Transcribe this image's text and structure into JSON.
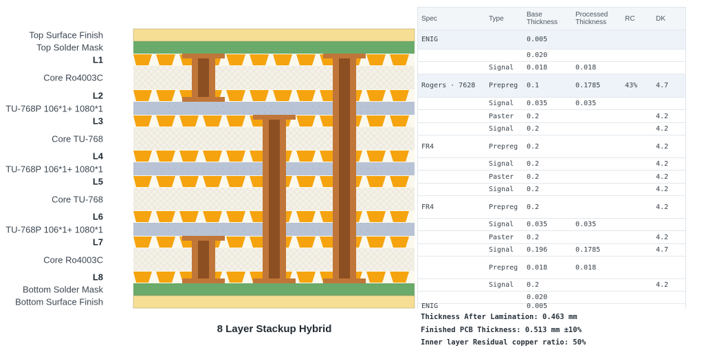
{
  "stackup": {
    "title": "8 Layer Stackup Hybrid",
    "colors": {
      "surface_finish": "#f6de94",
      "solder_mask": "#6aaa6a",
      "copper": "#f5a30e",
      "core": "#f3f0e6",
      "prepreg": "#b9c5d6",
      "via_outer": "#c07638",
      "via_inner": "#8c4f22"
    },
    "layers": [
      {
        "label": "Top Surface Finish",
        "kind": "finish",
        "bold": false
      },
      {
        "label": "Top Solder Mask",
        "kind": "mask",
        "bold": false
      },
      {
        "label": "L1",
        "kind": "copper",
        "bold": true
      },
      {
        "label": "Core Ro4003C",
        "kind": "core",
        "bold": false
      },
      {
        "label": "L2",
        "kind": "copper",
        "bold": true
      },
      {
        "label": "TU-768P 106*1+ 1080*1",
        "kind": "prepreg",
        "bold": false
      },
      {
        "label": "L3",
        "kind": "copper",
        "bold": true
      },
      {
        "label": "Core TU-768",
        "kind": "core",
        "bold": false
      },
      {
        "label": "L4",
        "kind": "copper",
        "bold": true
      },
      {
        "label": "TU-768P 106*1+ 1080*1",
        "kind": "prepreg",
        "bold": false
      },
      {
        "label": "L5",
        "kind": "copper",
        "bold": true
      },
      {
        "label": "Core TU-768",
        "kind": "core",
        "bold": false
      },
      {
        "label": "L6",
        "kind": "copper",
        "bold": true
      },
      {
        "label": "TU-768P 106*1+ 1080*1",
        "kind": "prepreg",
        "bold": false
      },
      {
        "label": "L7",
        "kind": "copper",
        "bold": true
      },
      {
        "label": "Core Ro4003C",
        "kind": "core",
        "bold": false
      },
      {
        "label": "L8",
        "kind": "copper",
        "bold": true
      },
      {
        "label": "Bottom Solder Mask",
        "kind": "mask",
        "bold": false
      },
      {
        "label": "Bottom Surface Finish",
        "kind": "finish",
        "bold": false
      }
    ],
    "vias": [
      {
        "name": "via-blind-top",
        "from_layer": "L1",
        "to_layer": "L2"
      },
      {
        "name": "via-blind-bottom",
        "from_layer": "L7",
        "to_layer": "L8"
      },
      {
        "name": "via-buried",
        "from_layer": "L3",
        "to_layer": "L8"
      },
      {
        "name": "via-through",
        "from_layer": "L1",
        "to_layer": "L8"
      }
    ]
  },
  "table": {
    "headers": {
      "spec": "Spec",
      "type": "Type",
      "base_l1": "Base",
      "base_l2": "Thickness",
      "proc_l1": "Processed",
      "proc_l2": "Thickness",
      "rc": "RC",
      "dk": "DK"
    },
    "rows": [
      {
        "spec": "ENIG",
        "type": "",
        "base": "0.005",
        "processed": "",
        "rc": "",
        "dk": ""
      },
      {
        "spec": "",
        "type": "",
        "base": "0.020",
        "processed": "",
        "rc": "",
        "dk": ""
      },
      {
        "spec": "",
        "type": "Signal",
        "base": "0.018",
        "processed": "0.018",
        "rc": "",
        "dk": ""
      },
      {
        "spec": "Rogers · 7628",
        "type": "Prepreg",
        "base": "0.1",
        "processed": "0.1785",
        "rc": "43%",
        "dk": "4.7"
      },
      {
        "spec": "",
        "type": "Signal",
        "base": "0.035",
        "processed": "0.035",
        "rc": "",
        "dk": ""
      },
      {
        "spec": "",
        "type": "Paster",
        "base": "0.2",
        "processed": "",
        "rc": "",
        "dk": "4.2"
      },
      {
        "spec": "",
        "type": "Signal",
        "base": "0.2",
        "processed": "",
        "rc": "",
        "dk": "4.2"
      },
      {
        "spec": "FR4",
        "type": "Prepreg",
        "base": "0.2",
        "processed": "",
        "rc": "",
        "dk": "4.2"
      },
      {
        "spec": "",
        "type": "Signal",
        "base": "0.2",
        "processed": "",
        "rc": "",
        "dk": "4.2"
      },
      {
        "spec": "",
        "type": "Paster",
        "base": "0.2",
        "processed": "",
        "rc": "",
        "dk": "4.2"
      },
      {
        "spec": "",
        "type": "Signal",
        "base": "0.2",
        "processed": "",
        "rc": "",
        "dk": "4.2"
      },
      {
        "spec": "FR4",
        "type": "Prepreg",
        "base": "0.2",
        "processed": "",
        "rc": "",
        "dk": "4.2"
      },
      {
        "spec": "",
        "type": "Signal",
        "base": "0.035",
        "processed": "0.035",
        "rc": "",
        "dk": ""
      },
      {
        "spec": "",
        "type": "Paster",
        "base": "0.2",
        "processed": "",
        "rc": "",
        "dk": "4.2"
      },
      {
        "spec": "",
        "type": "Signal",
        "base": "0.196",
        "processed": "0.1785",
        "rc": "",
        "dk": "4.7"
      },
      {
        "spec": "",
        "type": "Prepreg",
        "base": "0.018",
        "processed": "0.018",
        "rc": "",
        "dk": ""
      },
      {
        "spec": "",
        "type": "Signal",
        "base": "0.2",
        "processed": "",
        "rc": "",
        "dk": "4.2"
      },
      {
        "spec": "",
        "type": "",
        "base": "0.020",
        "processed": "",
        "rc": "",
        "dk": ""
      },
      {
        "spec": "ENIG",
        "type": "",
        "base": "0.005",
        "processed": "",
        "rc": "",
        "dk": ""
      }
    ]
  },
  "summary": {
    "thickness_after_lamination": "Thickness After Lamination: 0.463 mm",
    "finished_pcb_thickness": "Finished PCB Thickness: 0.513 mm ±10%",
    "inner_layer_copper_ratio": "Inner layer Residual copper ratio: 50%"
  }
}
